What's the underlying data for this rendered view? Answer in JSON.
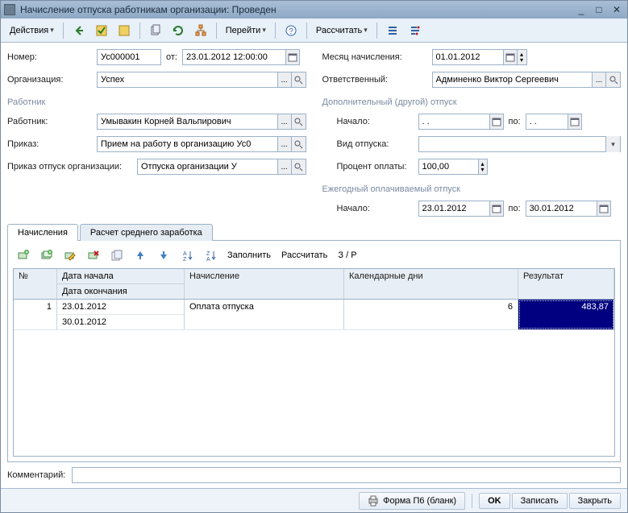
{
  "window": {
    "title": "Начисление отпуска работникам организации: Проведен"
  },
  "toolbar": {
    "actions_label": "Действия",
    "goto_label": "Перейти",
    "calculate_label": "Рассчитать"
  },
  "form": {
    "number_label": "Номер:",
    "number_value": "Ус000001",
    "date_label": "от:",
    "date_value": "23.01.2012 12:00:00",
    "month_label": "Месяц начисления:",
    "month_value": "01.01.2012",
    "org_label": "Организация:",
    "org_value": "Успех",
    "resp_label": "Ответственный:",
    "resp_value": "Админенко Виктор Сергеевич",
    "section_employee": "Работник",
    "employee_label": "Работник:",
    "employee_value": "Умывакин Корней Вальпирович",
    "order_label": "Приказ:",
    "order_value": "Прием на работу в организацию Ус0",
    "vacation_order_label": "Приказ отпуск организации:",
    "vacation_order_value": "Отпуска организации У",
    "section_additional": "Дополнительный (другой) отпуск",
    "add_start_label": "Начало:",
    "add_start_value": " .  .  ",
    "add_to_label": "по:",
    "add_end_value": " .  .  ",
    "vac_type_label": "Вид отпуска:",
    "vac_type_value": "",
    "pay_percent_label": "Процент оплаты:",
    "pay_percent_value": "100,00",
    "section_annual": "Ежегодный оплачиваемый отпуск",
    "annual_start_label": "Начало:",
    "annual_start_value": "23.01.2012",
    "annual_to_label": "по:",
    "annual_end_value": "30.01.2012"
  },
  "tabs": {
    "tab1": "Начисления",
    "tab2": "Расчет среднего заработка",
    "tb_fill": "Заполнить",
    "tb_calc": "Рассчитать",
    "tb_mode": "З / Р"
  },
  "table": {
    "headers": {
      "num": "№",
      "date_start": "Дата начала",
      "date_end": "Дата окончания",
      "accrual": "Начисление",
      "days": "Календарные дни",
      "result": "Результат"
    },
    "rows": [
      {
        "num": "1",
        "date_start": "23.01.2012",
        "date_end": "30.01.2012",
        "accrual": "Оплата отпуска",
        "days": "6",
        "result": "483,87"
      }
    ]
  },
  "comment": {
    "label": "Комментарий:",
    "value": ""
  },
  "status": {
    "form_p6": "Форма П6 (бланк)",
    "ok": "OK",
    "save": "Записать",
    "close": "Закрыть"
  }
}
